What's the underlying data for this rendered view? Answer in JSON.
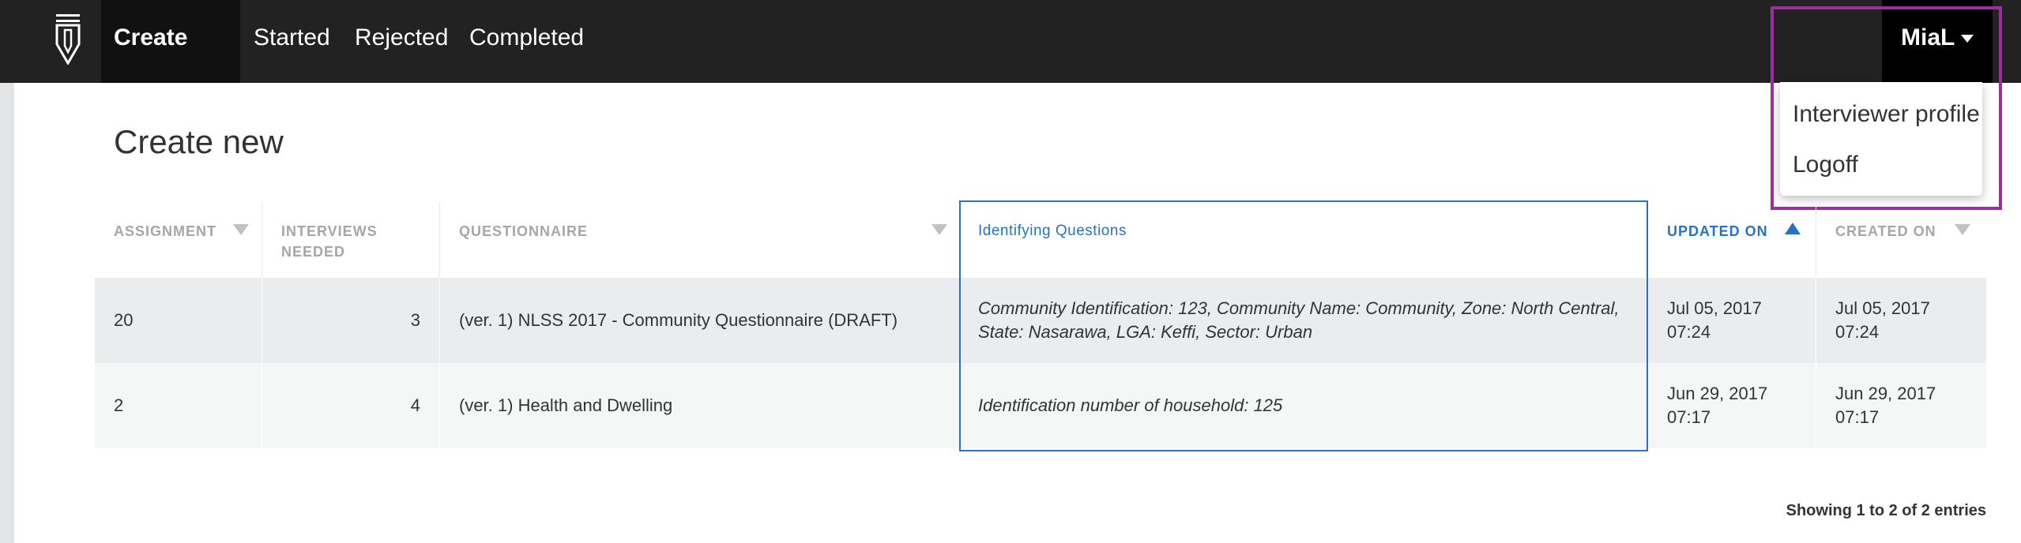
{
  "nav": {
    "tabs": [
      {
        "label": "Create new",
        "active": true
      },
      {
        "label": "Started"
      },
      {
        "label": "Rejected"
      },
      {
        "label": "Completed"
      }
    ],
    "user": "MiaL"
  },
  "dropdown": {
    "items": [
      "Interviewer profile",
      "Logoff"
    ]
  },
  "page": {
    "title": "Create new"
  },
  "table": {
    "columns": {
      "assignment": "ASSIGNMENT",
      "interviews_needed": "INTERVIEWS NEEDED",
      "questionnaire": "QUESTIONNAIRE",
      "identifying_questions": "Identifying Questions",
      "updated_on": "UPDATED ON",
      "created_on": "CREATED ON"
    },
    "rows": [
      {
        "assignment": "20",
        "interviews_needed": "3",
        "questionnaire": "(ver. 1) NLSS 2017 - Community Questionnaire (DRAFT)",
        "identifying_questions": "Community Identification: 123, Community Name: Community, Zone: North Central, State: Nasarawa, LGA: Keffi, Sector: Urban",
        "updated_on": "Jul 05, 2017 07:24",
        "created_on": "Jul 05, 2017 07:24"
      },
      {
        "assignment": "2",
        "interviews_needed": "4",
        "questionnaire": "(ver. 1) Health and Dwelling",
        "identifying_questions": "Identification number of household: 125",
        "updated_on": "Jun 29, 2017 07:17",
        "created_on": "Jun 29, 2017 07:17"
      }
    ]
  },
  "footer": {
    "entries": "Showing 1 to 2 of 2 entries"
  },
  "colors": {
    "navbar": "#222222",
    "accent_blue": "#2672c6",
    "highlight_purple": "#9c2e9e"
  }
}
